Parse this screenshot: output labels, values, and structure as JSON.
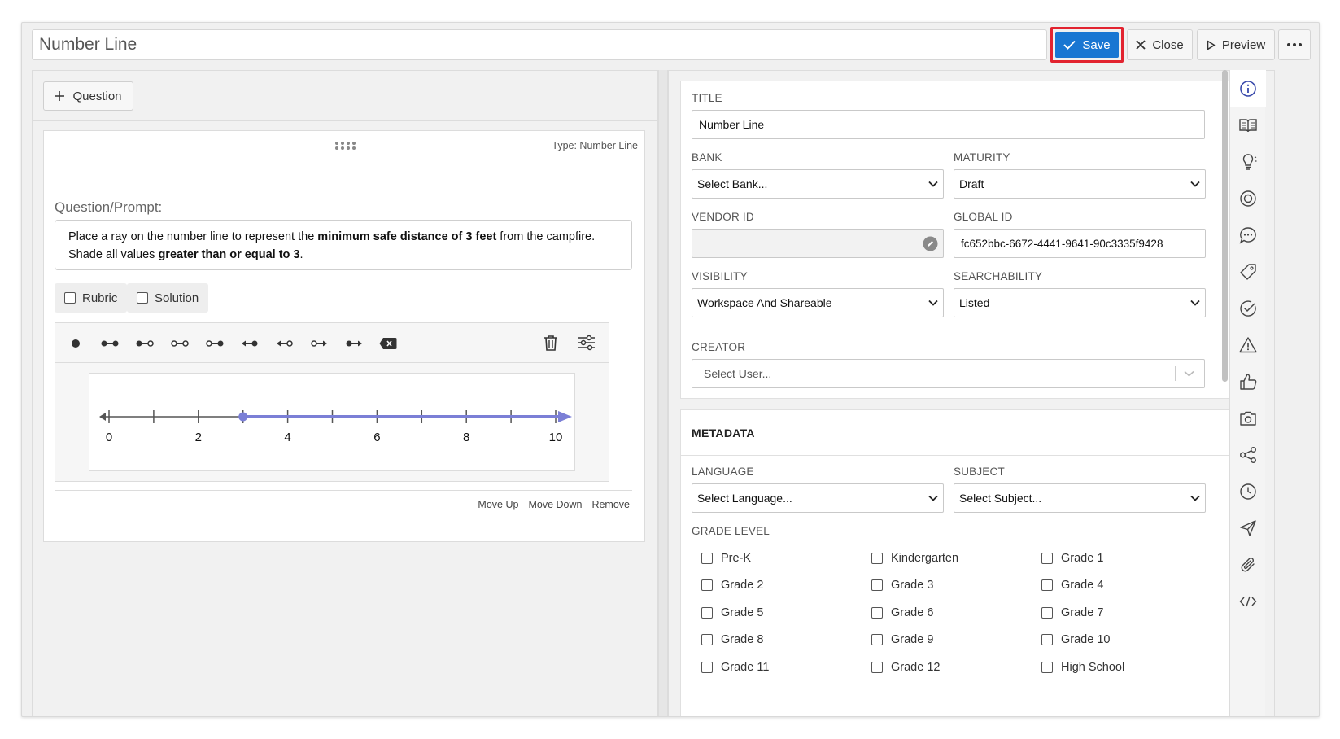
{
  "header": {
    "title": "Number Line",
    "save_label": "Save",
    "close_label": "Close",
    "preview_label": "Preview"
  },
  "left": {
    "add_question_label": "Question",
    "question_type": "Type: Number Line",
    "prompt_label": "Question/Prompt:",
    "prompt": {
      "line1_a": "Place a ray on the number line to represent the ",
      "line1_b": "minimum safe distance of 3 feet",
      "line1_c": " from the campfire.",
      "line2_a": "Shade all values ",
      "line2_b": "greater than or equal to 3",
      "line2_c": "."
    },
    "rubric_label": "Rubric",
    "solution_label": "Solution",
    "number_line": {
      "min": 0,
      "max": 10,
      "tick_step": 1,
      "labels": [
        "0",
        "2",
        "4",
        "6",
        "8",
        "10"
      ],
      "ray_start": 3,
      "ray_direction": "right",
      "ray_closed": true,
      "ray_color": "#7b7fd6"
    },
    "footer": {
      "move_up": "Move Up",
      "move_down": "Move Down",
      "remove": "Remove"
    }
  },
  "right": {
    "title_label": "TITLE",
    "title_value": "Number Line",
    "bank_label": "BANK",
    "bank_value": "Select Bank...",
    "maturity_label": "MATURITY",
    "maturity_value": "Draft",
    "vendor_id_label": "VENDOR ID",
    "vendor_id_value": "",
    "global_id_label": "GLOBAL ID",
    "global_id_value": "fc652bbc-6672-4441-9641-90c3335f9428",
    "visibility_label": "VISIBILITY",
    "visibility_value": "Workspace And Shareable",
    "searchability_label": "SEARCHABILITY",
    "searchability_value": "Listed",
    "creator_label": "CREATOR",
    "creator_placeholder": "Select User...",
    "metadata_title": "METADATA",
    "language_label": "LANGUAGE",
    "language_value": "Select Language...",
    "subject_label": "SUBJECT",
    "subject_value": "Select Subject...",
    "grade_level_label": "GRADE LEVEL",
    "grades": [
      "Pre-K",
      "Kindergarten",
      "Grade 1",
      "Grade 2",
      "Grade 3",
      "Grade 4",
      "Grade 5",
      "Grade 6",
      "Grade 7",
      "Grade 8",
      "Grade 9",
      "Grade 10",
      "Grade 11",
      "Grade 12",
      "High School"
    ]
  },
  "rail_icons": [
    "info-icon",
    "book-icon",
    "lightbulb-icon",
    "target-icon",
    "comment-icon",
    "tag-icon",
    "check-circle-icon",
    "warning-icon",
    "thumbs-up-icon",
    "camera-icon",
    "share-icon",
    "clock-icon",
    "send-icon",
    "paperclip-icon",
    "code-icon"
  ],
  "colors": {
    "save_blue": "#1976d2",
    "highlight_red": "#e2232f",
    "info_active": "#3949ab"
  }
}
